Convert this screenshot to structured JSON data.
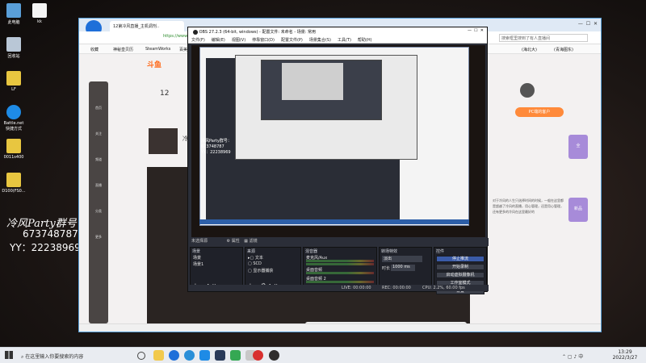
{
  "desktop": {
    "icons": [
      {
        "label": "此电脑"
      },
      {
        "label": "kk"
      },
      {
        "label": "回收站"
      },
      {
        "label": "LF"
      },
      {
        "label": "Battle.net\n快捷方式"
      },
      {
        "label": "0011s400"
      },
      {
        "label": "D100(FS0..."
      }
    ],
    "overlay": {
      "line1": "冷风Party群号：",
      "line2": "673748787",
      "line3": "YY：22238969"
    }
  },
  "browser": {
    "tab_title": "12第冷风直播_主机调剂..",
    "address": "https://www.",
    "bookmarks": [
      "收藏",
      "神秘皇贝历",
      "SteamWorks",
      "百美"
    ],
    "right_bookmarks": [
      "(海北大)",
      "(青海图东)"
    ],
    "search_hint": "搜索框里搜到了有人直播间",
    "page_logo": "斗鱼",
    "room_number": "12",
    "streamer_short": "冷",
    "right_badge": "PC端的客户",
    "right_cards": [
      "全",
      "新品"
    ],
    "body_text": "对于冷风的人生只选择时间的时候，一般在这里都是超越了冷风的直播，用心管理，还是用心管理，还有更多的冷风在这里最好的",
    "sidebar_labels": [
      "首页",
      "关注",
      "频道",
      "直播",
      "分类",
      "更多"
    ]
  },
  "obs": {
    "window_title": "OBS 27.2.3 (64-bit, windows) - 配置文件: 未命名 - 场景: 常用",
    "menu": [
      "文件(F)",
      "编辑(E)",
      "视图(V)",
      "停靠窗口(D)",
      "配置文件(P)",
      "场景集合(S)",
      "工具(T)",
      "帮助(H)"
    ],
    "source_tab": {
      "title": "未选择源",
      "properties": "属性",
      "filters": "滤镜"
    },
    "scenes": {
      "title": "场景",
      "items": [
        "场景",
        "场景1"
      ]
    },
    "sources": {
      "title": "来源",
      "items": [
        "文本",
        "SCD",
        "显示器捕获"
      ]
    },
    "mixer": {
      "title": "混音器",
      "channels": [
        {
          "name": "麦克风/Aux",
          "db": "0.0 dB"
        },
        {
          "name": "桌面音频",
          "db": "0.0 dB"
        },
        {
          "name": "桌面音频 2",
          "db": "0.0 dB"
        }
      ]
    },
    "transitions": {
      "title": "转场特效",
      "type": "淡出",
      "duration_label": "时长",
      "duration_value": "1000 ms"
    },
    "controls": {
      "title": "控件",
      "buttons": [
        "停止推流",
        "开始录制",
        "启动虚拟摄像机",
        "工作室模式",
        "设置",
        "退出"
      ]
    },
    "status": {
      "live": "LIVE: 00:00:00",
      "rec": "REC: 00:00:00",
      "cpu": "CPU: 2.2%, 60.00 fps"
    }
  },
  "taskbar": {
    "search_placeholder": "在这里输入你要搜索的内容",
    "time": "13:29",
    "date": "2022/3/27",
    "lang": "中"
  },
  "colors": {
    "taskbar_bg": "#e9ecf1",
    "obs_bg": "#2b2e38",
    "obs_panel": "#1f2129",
    "accent_blue": "#1e6fd9",
    "brand_orange": "#ff6a1a"
  }
}
